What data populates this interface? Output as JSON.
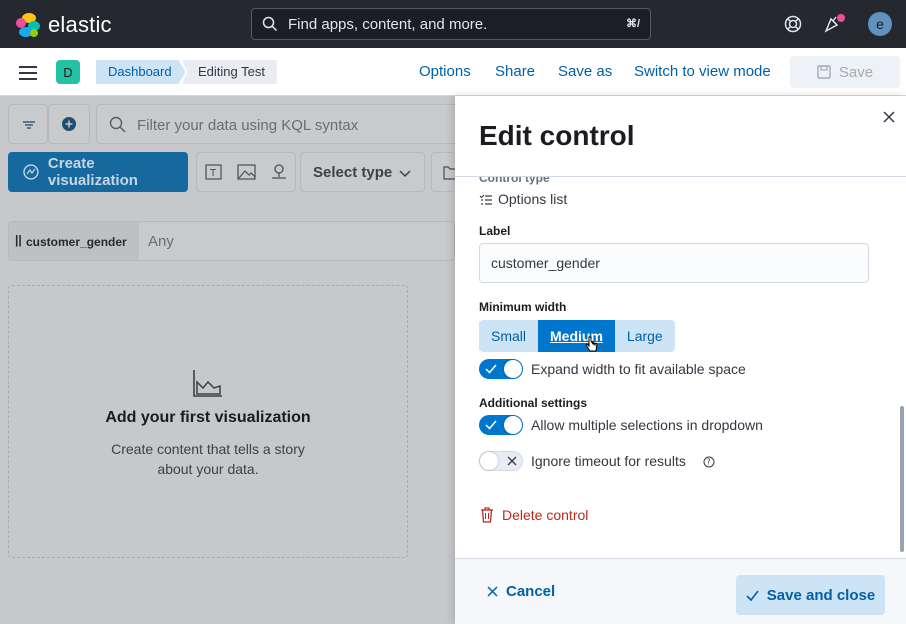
{
  "header": {
    "brand": "elastic",
    "search_placeholder": "Find apps, content, and more.",
    "search_shortcut": "⌘/",
    "user_initial": "e"
  },
  "nav": {
    "space_initial": "D",
    "breadcrumbs": [
      "Dashboard",
      "Editing Test"
    ],
    "links": [
      "Options",
      "Share",
      "Save as",
      "Switch to view mode"
    ],
    "save_label": "Save"
  },
  "background": {
    "query_placeholder": "Filter your data using KQL syntax",
    "create_visualization": "Create visualization",
    "select_type": "Select type",
    "control_label": "customer_gender",
    "control_value": "Any",
    "empty_title": "Add your first visualization",
    "empty_desc_line1": "Create content that tells a story",
    "empty_desc_line2": "about your data."
  },
  "flyout": {
    "title": "Edit control",
    "control_type_label": "Control type",
    "control_type_value": "Options list",
    "label_field_label": "Label",
    "label_value": "customer_gender",
    "min_width_label": "Minimum width",
    "widths": [
      "Small",
      "Medium",
      "Large"
    ],
    "width_selected": "Medium",
    "expand_label": "Expand width to fit available space",
    "expand_on": true,
    "additional_label": "Additional settings",
    "multi_label": "Allow multiple selections in dropdown",
    "multi_on": true,
    "timeout_label": "Ignore timeout for results",
    "timeout_on": false,
    "delete_label": "Delete control",
    "cancel_label": "Cancel",
    "save_close_label": "Save and close"
  },
  "colors": {
    "primary": "#0077cc",
    "danger": "#bd271e",
    "topbar": "#25282f"
  }
}
